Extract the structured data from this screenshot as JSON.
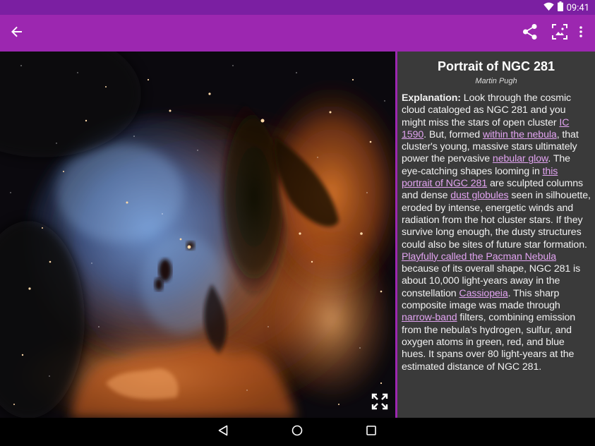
{
  "status_bar": {
    "time": "09:41",
    "wifi_icon": "wifi-icon",
    "battery_icon": "battery-icon"
  },
  "app_bar": {
    "back_icon": "arrow-back-icon",
    "actions": [
      {
        "name": "share-button",
        "icon": "share-icon"
      },
      {
        "name": "set-wallpaper-button",
        "icon": "wallpaper-icon"
      },
      {
        "name": "overflow-menu-button",
        "icon": "more-vert-icon"
      }
    ],
    "background": "#9c27b0",
    "status_background": "#7b1fa2"
  },
  "image": {
    "fullscreen_icon": "fullscreen-icon"
  },
  "article": {
    "title": "Portrait of NGC 281",
    "author": "Martin Pugh",
    "explanation_label": "Explanation:",
    "t1": " Look through the cosmic cloud cataloged as NGC 281 and you might miss the stars of open cluster ",
    "l1": "IC 1590",
    "t2": ". But, formed ",
    "l2": "within the nebula",
    "t3": ", that cluster's young, massive stars ultimately power the pervasive ",
    "l3": "nebular glow",
    "t4": ". The eye-catching shapes looming in ",
    "l4": "this portrait of NGC 281",
    "t5": " are sculpted columns and dense ",
    "l5": "dust globules",
    "t6": " seen in silhouette, eroded by intense, energetic winds and radiation from the hot cluster stars. If they survive long enough, the dusty structures could also be sites of future star formation. ",
    "l6": "Playfully called the Pacman Nebula",
    "t7": " because of its overall shape, NGC 281 is about 10,000 light-years away in the constellation ",
    "l7": "Cassiopeia",
    "t8": ". This sharp composite image was made through ",
    "l8": "narrow-band",
    "t9": " filters, combining emission from the nebula's hydrogen, sulfur, and oxygen atoms in green, red, and blue hues. It spans over 80 light-years at the estimated distance of NGC 281.",
    "link_color": "#e1a3f0",
    "panel_background": "#3a3a3a"
  },
  "nav_bar": {
    "back": "nav-back-icon",
    "home": "nav-home-icon",
    "recents": "nav-recents-icon"
  }
}
